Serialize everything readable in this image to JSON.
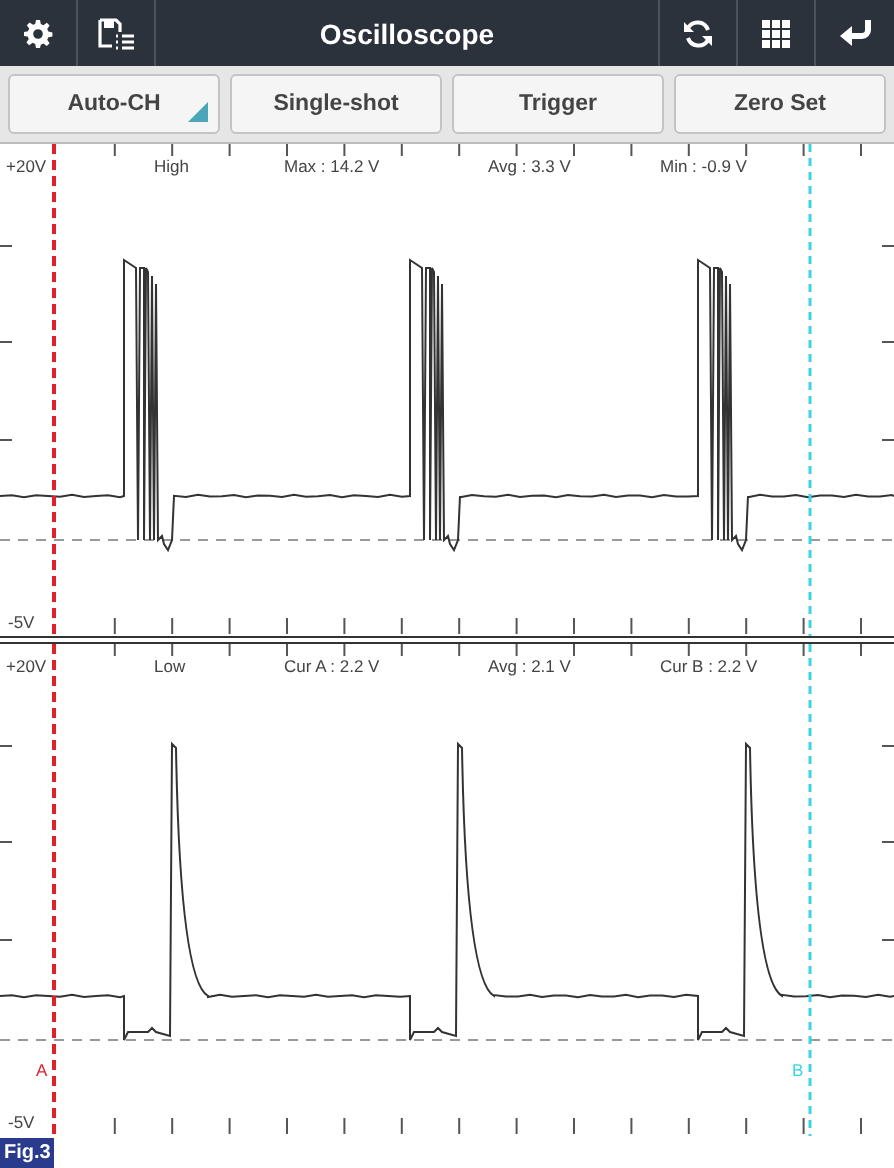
{
  "title": "Oscilloscope",
  "buttons": [
    {
      "label": "Auto-CH",
      "has_menu": true
    },
    {
      "label": "Single-shot",
      "has_menu": false
    },
    {
      "label": "Trigger",
      "has_menu": false
    },
    {
      "label": "Zero Set",
      "has_menu": false
    }
  ],
  "panels": [
    {
      "kind": "pulse_burst",
      "top_scale": "+20V",
      "bottom_scale": "-5V",
      "readouts": [
        "High",
        "Max : 14.2 V",
        "Avg : 3.3 V",
        "Min : -0.9 V"
      ]
    },
    {
      "kind": "spike",
      "top_scale": "+20V",
      "bottom_scale": "-5V",
      "readouts": [
        "Low",
        "Cur A : 2.2 V",
        "Avg : 2.1 V",
        "Cur B : 2.2 V"
      ],
      "cursor_labels": [
        "A",
        "B"
      ]
    }
  ],
  "figure_label": "Fig.3"
}
